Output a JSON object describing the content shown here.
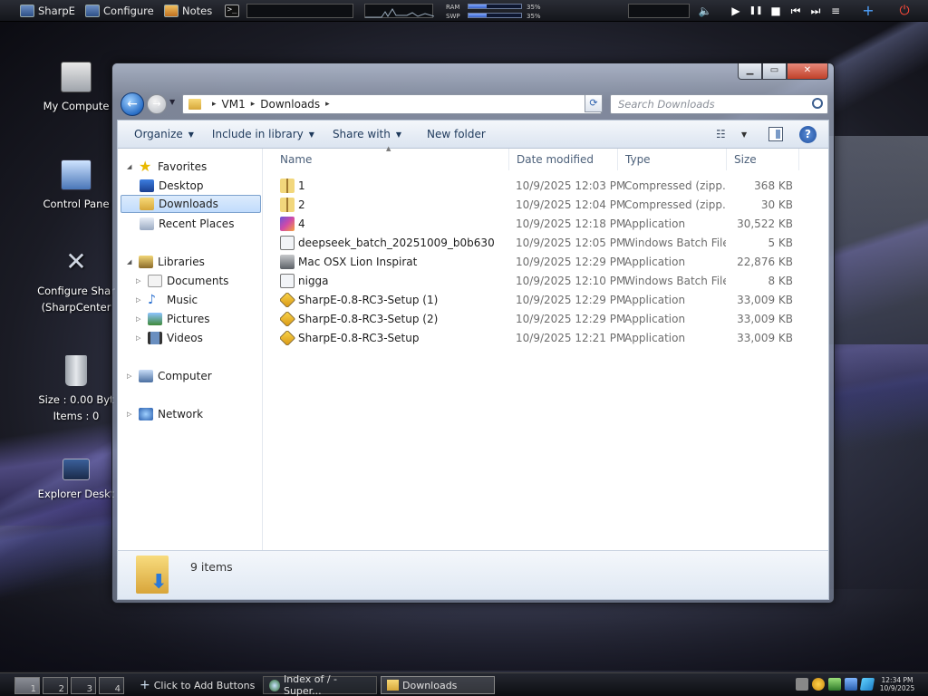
{
  "topbar": {
    "launchers": [
      {
        "label": "SharpE",
        "icon": "sharpe-icon"
      },
      {
        "label": "Configure",
        "icon": "configure-icon"
      },
      {
        "label": "Notes",
        "icon": "notes-icon"
      }
    ],
    "terminal_icon": ">_",
    "ram_label": "RAM",
    "swp_label": "SWP",
    "ram_value": "35%",
    "swp_value": "35%",
    "ram_fraction": 0.35,
    "swp_fraction": 0.35,
    "media": {
      "play": "▶",
      "pause": "❚❚",
      "stop": "■",
      "prev": "⏮",
      "next": "⏭"
    },
    "add": "+",
    "power": "⏻"
  },
  "desktop_icons": [
    {
      "lines": [
        "My Compute"
      ],
      "icon": "monitor-icon"
    },
    {
      "lines": [
        "Control Pane"
      ],
      "icon": "control-panel-icon"
    },
    {
      "lines": [
        "Configure Shar",
        "(SharpCenter"
      ],
      "icon": "tools-icon"
    },
    {
      "lines": [
        "Size : 0.00 Byt",
        "Items : 0"
      ],
      "icon": "recycle-bin-icon"
    },
    {
      "lines": [
        "Explorer Deskt"
      ],
      "icon": "explorer-desktop-icon"
    }
  ],
  "window": {
    "buttons": {
      "minimize": "▁",
      "maximize": "▭",
      "close": "✕"
    },
    "address": {
      "segments": [
        "VM1",
        "Downloads"
      ],
      "separator": "▸"
    },
    "search_placeholder": "Search Downloads",
    "commands": {
      "organize": "Organize",
      "include": "Include in library",
      "share": "Share with",
      "newfolder": "New folder"
    },
    "nav": {
      "favorites": "Favorites",
      "desktop": "Desktop",
      "downloads": "Downloads",
      "recent": "Recent Places",
      "libraries": "Libraries",
      "documents": "Documents",
      "music": "Music",
      "pictures": "Pictures",
      "videos": "Videos",
      "computer": "Computer",
      "network": "Network"
    },
    "columns": {
      "name": "Name",
      "date": "Date modified",
      "type": "Type",
      "size": "Size"
    },
    "files": [
      {
        "name": "1",
        "date": "10/9/2025 12:03 PM",
        "type": "Compressed (zipp...",
        "size": "368 KB",
        "icon": "zip"
      },
      {
        "name": "2",
        "date": "10/9/2025 12:04 PM",
        "type": "Compressed (zipp...",
        "size": "30 KB",
        "icon": "zip"
      },
      {
        "name": "4",
        "date": "10/9/2025 12:18 PM",
        "type": "Application",
        "size": "30,522 KB",
        "icon": "app4"
      },
      {
        "name": "deepseek_batch_20251009_b0b630",
        "date": "10/9/2025 12:05 PM",
        "type": "Windows Batch File",
        "size": "5 KB",
        "icon": "bat"
      },
      {
        "name": "Mac OSX Lion Inspirat",
        "date": "10/9/2025 12:29 PM",
        "type": "Application",
        "size": "22,876 KB",
        "icon": "mac"
      },
      {
        "name": "nigga",
        "date": "10/9/2025 12:10 PM",
        "type": "Windows Batch File",
        "size": "8 KB",
        "icon": "bat"
      },
      {
        "name": "SharpE-0.8-RC3-Setup (1)",
        "date": "10/9/2025 12:29 PM",
        "type": "Application",
        "size": "33,009 KB",
        "icon": "sharp"
      },
      {
        "name": "SharpE-0.8-RC3-Setup (2)",
        "date": "10/9/2025 12:29 PM",
        "type": "Application",
        "size": "33,009 KB",
        "icon": "sharp"
      },
      {
        "name": "SharpE-0.8-RC3-Setup",
        "date": "10/9/2025 12:21 PM",
        "type": "Application",
        "size": "33,009 KB",
        "icon": "sharp"
      }
    ],
    "status": "9 items"
  },
  "taskbar": {
    "workspaces": [
      "1",
      "2",
      "3",
      "4"
    ],
    "add_buttons": "Click to Add Buttons",
    "tasks": [
      {
        "label": "Index of / - Super...",
        "icon": "globe-icon"
      },
      {
        "label": "Downloads",
        "icon": "folder-icon"
      }
    ],
    "time": "12:34 PM",
    "date": "10/9/2025"
  }
}
